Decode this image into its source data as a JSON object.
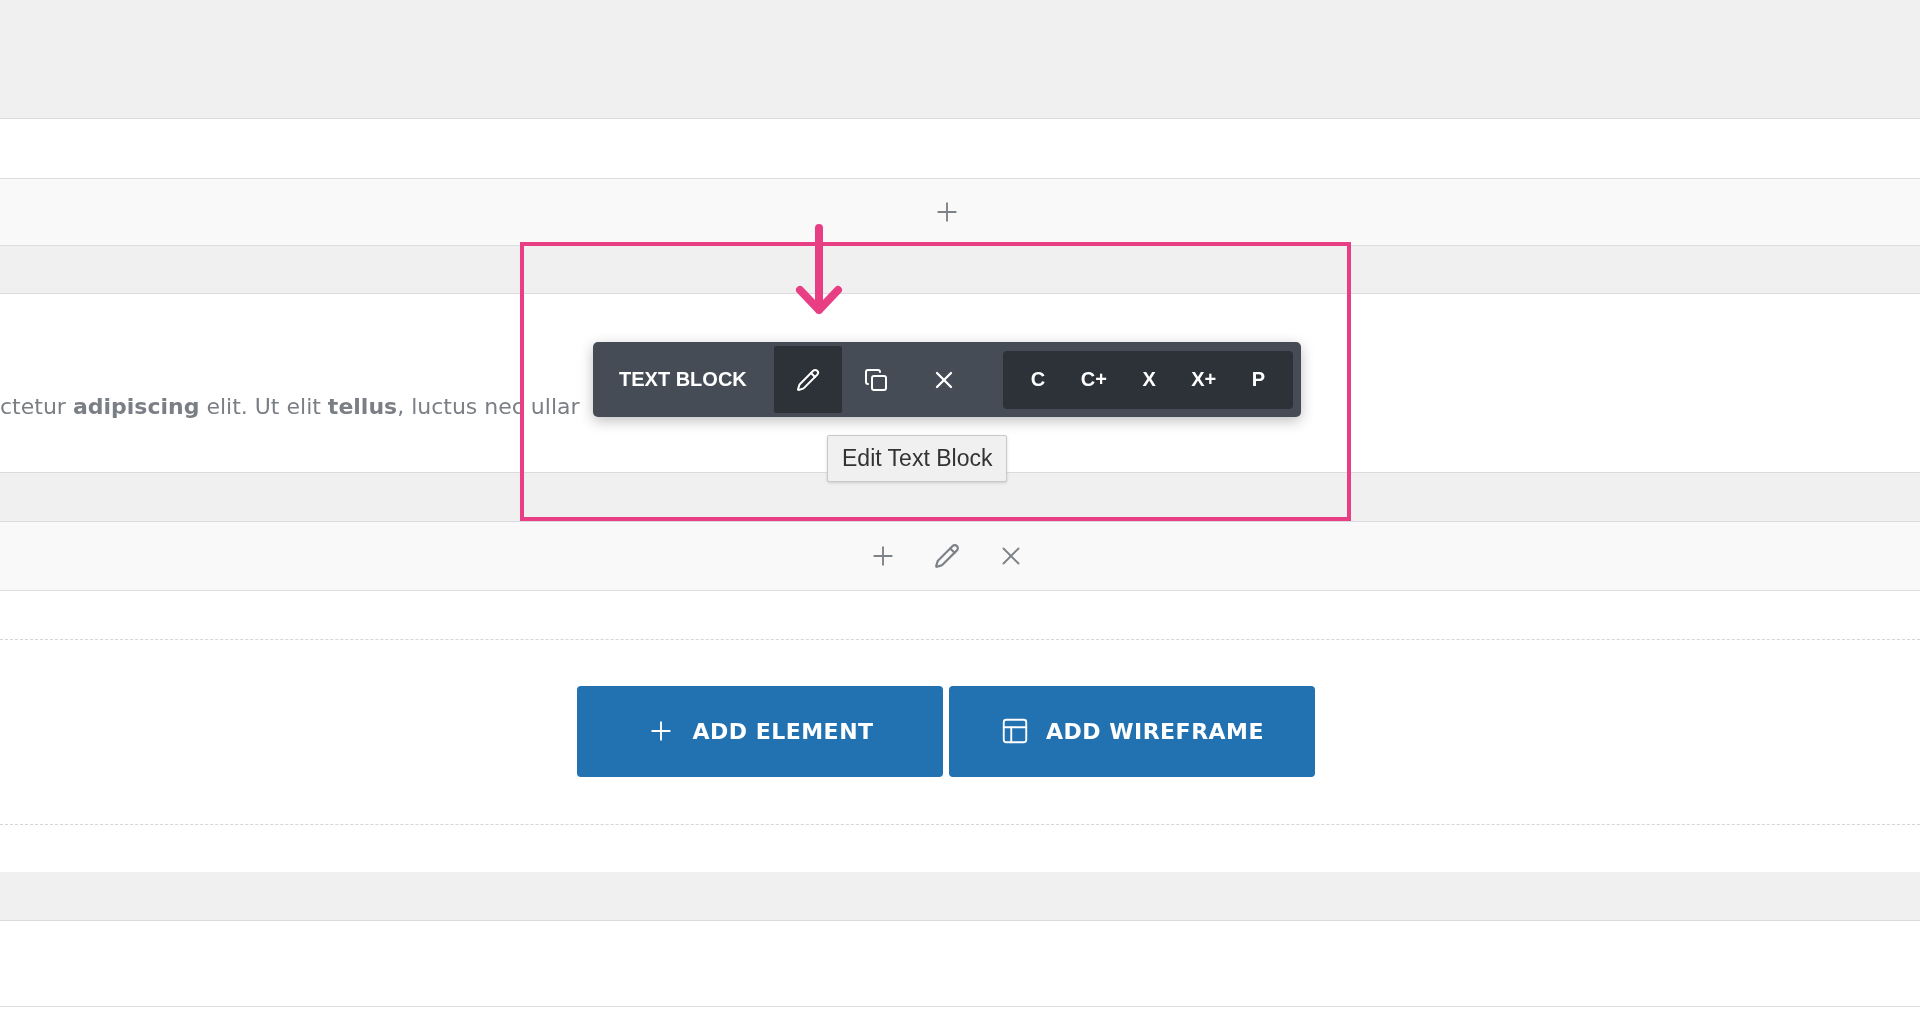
{
  "paragraph": {
    "text": "ctetur **adipiscing** elit. Ut elit **tellus**, luctus nec ullar"
  },
  "toolbar": {
    "label": "TEXT BLOCK",
    "tools": [
      {
        "kind": "edit",
        "selected": true
      },
      {
        "kind": "copy",
        "selected": false
      },
      {
        "kind": "delete",
        "selected": false
      }
    ],
    "shortcuts": [
      "C",
      "C+",
      "X",
      "X+",
      "P"
    ],
    "tooltip": "Edit Text Block"
  },
  "add_buttons": [
    {
      "kind": "element",
      "label": "ADD ELEMENT"
    },
    {
      "kind": "wireframe",
      "label": "ADD WIREFRAME"
    }
  ]
}
